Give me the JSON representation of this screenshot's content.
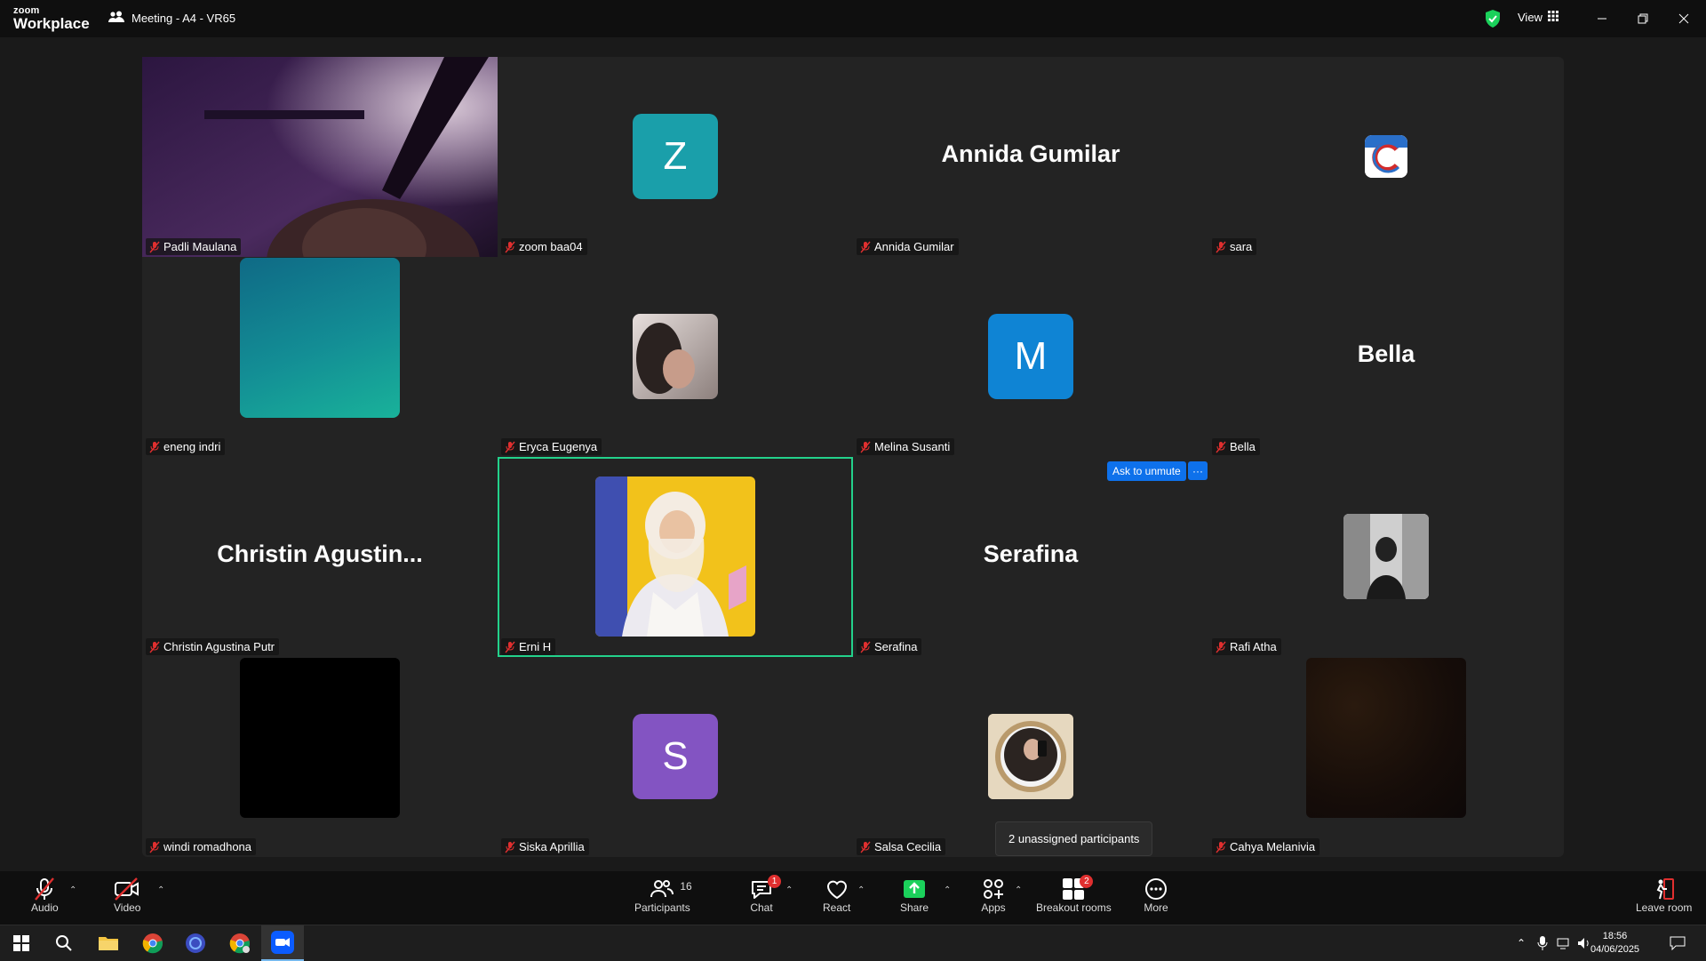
{
  "titlebar": {
    "logo_small": "zoom",
    "logo_big": "Workplace",
    "meeting_title": "Meeting - A4 - VR65",
    "view_label": "View"
  },
  "tiles": [
    {
      "name": "Padli Maulana",
      "display": "video"
    },
    {
      "name": "zoom baa04",
      "display": "letter",
      "letter": "Z",
      "color": "#1a9faa"
    },
    {
      "name": "Annida Gumilar",
      "display": "bigname",
      "bigname": "Annida Gumilar"
    },
    {
      "name": "sara",
      "display": "logo"
    },
    {
      "name": "eneng indri",
      "display": "photo-teal"
    },
    {
      "name": "Eryca Eugenya",
      "display": "photo-small"
    },
    {
      "name": "Melina Susanti",
      "display": "letter",
      "letter": "M",
      "color": "#0f84d4"
    },
    {
      "name": "Bella",
      "display": "bigname",
      "bigname": "Bella"
    },
    {
      "name": "Christin Agustina Putr",
      "display": "bigname",
      "bigname": "Christin  Agustin..."
    },
    {
      "name": "Erni H",
      "display": "photo-yellow",
      "active": true
    },
    {
      "name": "Serafina",
      "display": "bigname",
      "bigname": "Serafina"
    },
    {
      "name": "Rafi Atha",
      "display": "photo-bw"
    },
    {
      "name": "windi romadhona",
      "display": "black"
    },
    {
      "name": "Siska Aprillia",
      "display": "letter",
      "letter": "S",
      "color": "#8354c2"
    },
    {
      "name": "Salsa Cecilia",
      "display": "photo-circle"
    },
    {
      "name": "Cahya Melanivia",
      "display": "dark"
    }
  ],
  "hover_actions": {
    "ask_unmute": "Ask to unmute",
    "more": "···"
  },
  "tooltip": "2 unassigned participants",
  "toolbar": {
    "audio": "Audio",
    "video": "Video",
    "participants": "Participants",
    "participants_count": "16",
    "chat": "Chat",
    "chat_badge": "1",
    "react": "React",
    "share": "Share",
    "apps": "Apps",
    "breakout": "Breakout rooms",
    "breakout_badge": "2",
    "more": "More",
    "leave": "Leave room"
  },
  "taskbar": {
    "time": "18:56",
    "date": "04/06/2025"
  },
  "colors": {
    "accent_green": "#23d18b",
    "zoom_blue": "#0e71eb",
    "muted_red": "#e02f2f",
    "share_green": "#1bd15b"
  }
}
